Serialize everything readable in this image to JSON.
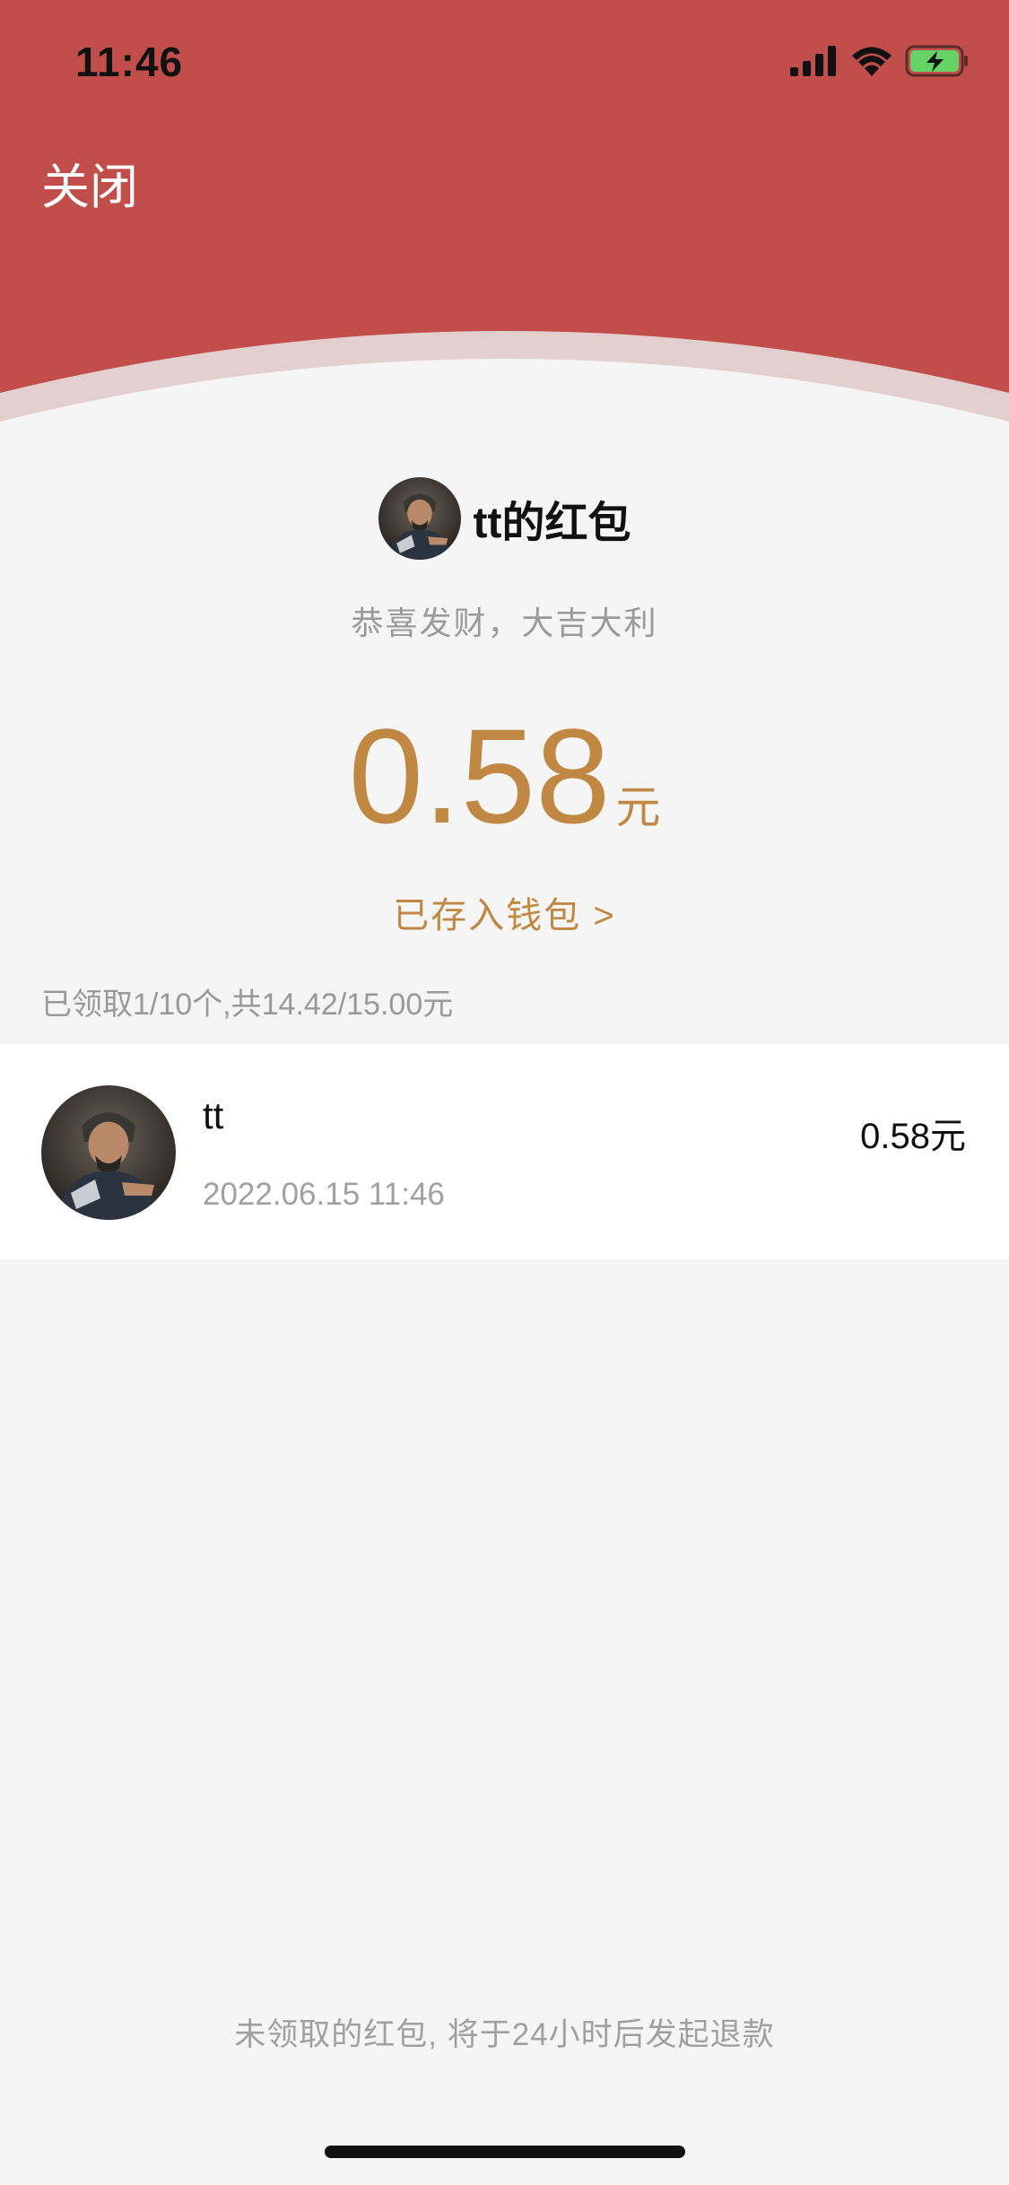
{
  "status_bar": {
    "time": "11:46",
    "icons": [
      "signal-icon",
      "wifi-icon",
      "battery-charging-icon"
    ]
  },
  "header": {
    "close_label": "关闭",
    "color": "#c24e4b"
  },
  "packet": {
    "sender_name": "tt的红包",
    "greeting": "恭喜发财，大吉大利",
    "amount": "0.58",
    "unit": "元",
    "wallet_link": "已存入钱包 >",
    "summary": "已领取1/10个,共14.42/15.00元",
    "accent_color": "#c08842"
  },
  "records": [
    {
      "name": "tt",
      "time": "2022.06.15 11:46",
      "amount": "0.58元"
    }
  ],
  "footer_note": "未领取的红包, 将于24小时后发起退款"
}
